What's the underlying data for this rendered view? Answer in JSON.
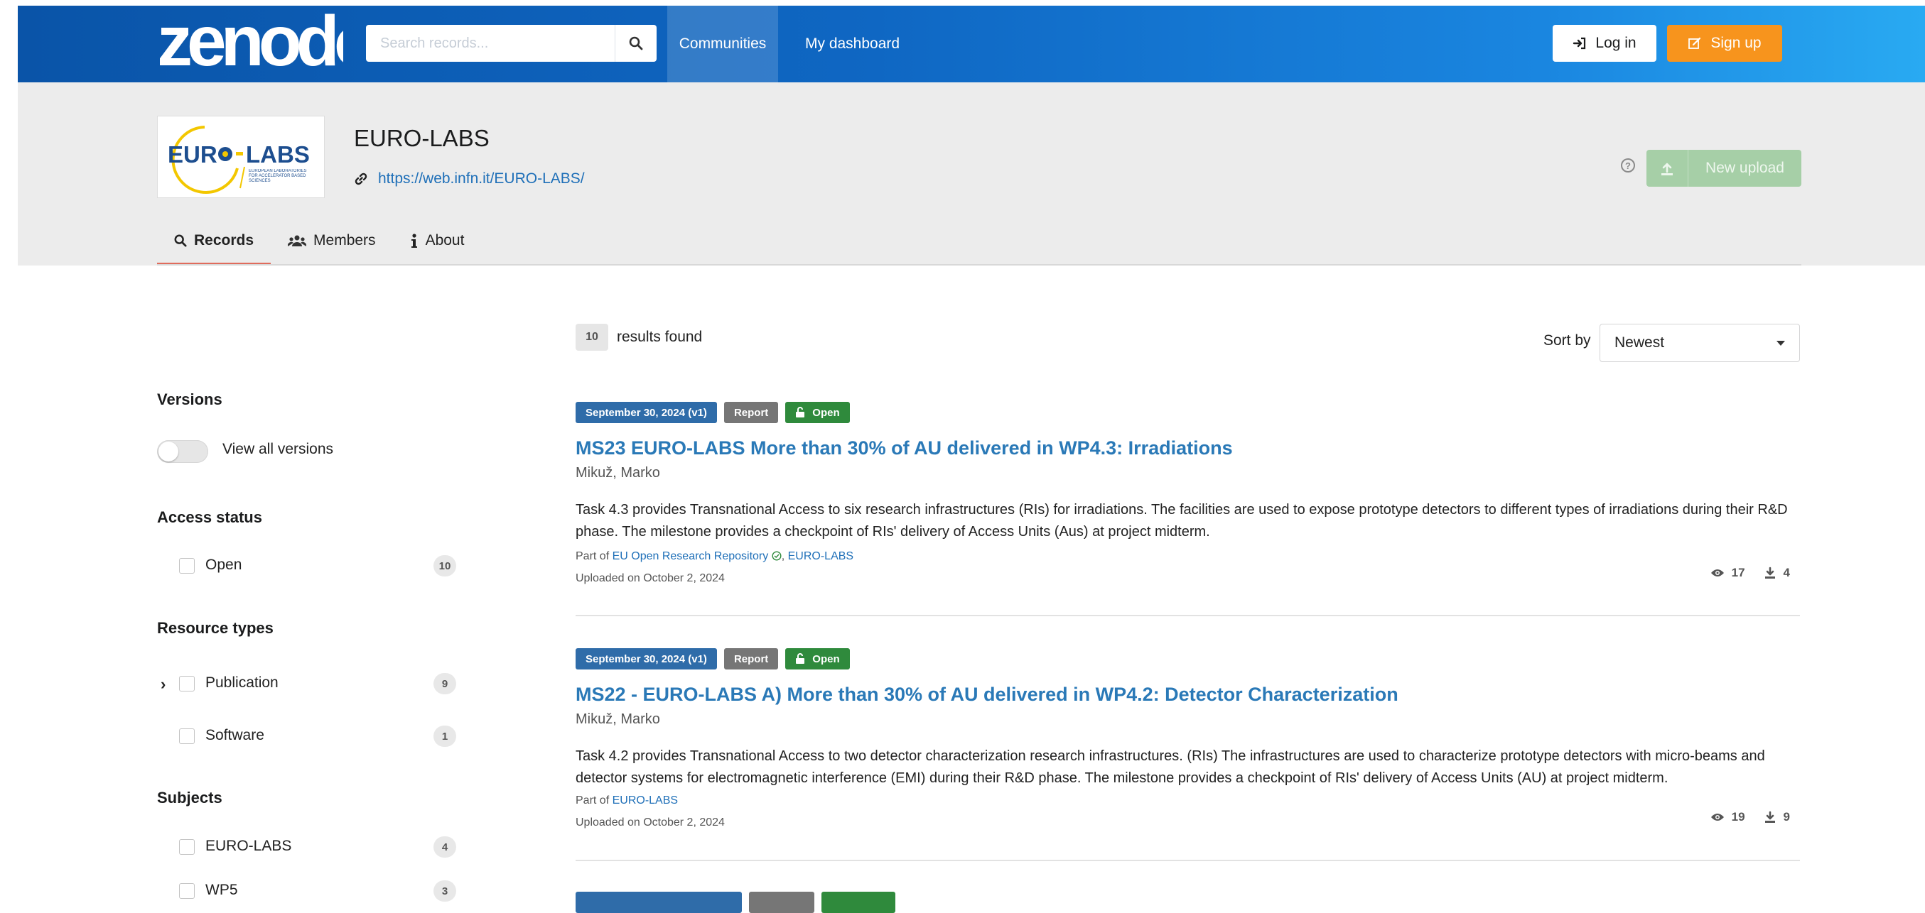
{
  "header": {
    "logo_text": "zenodo",
    "search_placeholder": "Search records...",
    "nav_communities": "Communities",
    "nav_dashboard": "My dashboard",
    "login_label": "Log in",
    "signup_label": "Sign up",
    "colors": {
      "gradient_start": "#0a54a8",
      "gradient_end": "#29aaf2",
      "signup": "#f7941d"
    }
  },
  "community": {
    "title": "EURO-LABS",
    "link": "https://web.infn.it/EURO-LABS/",
    "logo_text_1": "EUR",
    "logo_text_2": "LABS",
    "logo_tagline": "EUROPEAN LABORATORIES FOR ACCELERATOR BASED SCIENCES",
    "new_upload_label": "New upload",
    "tabs": [
      {
        "label": "Records",
        "icon": "search-icon",
        "active": true
      },
      {
        "label": "Members",
        "icon": "users-icon",
        "active": false
      },
      {
        "label": "About",
        "icon": "info-icon",
        "active": false
      }
    ]
  },
  "sidebar": {
    "versions_heading": "Versions",
    "view_all_versions": "View all versions",
    "access_heading": "Access status",
    "access_items": [
      {
        "label": "Open",
        "count": "10"
      }
    ],
    "resource_heading": "Resource types",
    "resource_items": [
      {
        "label": "Publication",
        "count": "9"
      },
      {
        "label": "Software",
        "count": "1"
      }
    ],
    "subjects_heading": "Subjects",
    "subject_items": [
      {
        "label": "EURO-LABS",
        "count": "4"
      },
      {
        "label": "WP5",
        "count": "3"
      }
    ]
  },
  "results": {
    "count": "10",
    "label": "results found",
    "sort_label": "Sort by",
    "sort_value": "Newest"
  },
  "records": [
    {
      "date": "September 30, 2024 (v1)",
      "type": "Report",
      "access": "Open",
      "title": "MS23 EURO-LABS More than 30% of AU delivered in WP4.3: Irradiations",
      "author": "Mikuž, Marko",
      "description": "Task 4.3 provides Transnational Access to six research infrastructures (RIs) for irradiations. The facilities are used to expose prototype detectors to different types of irradiations during their R&D phase. The milestone provides a checkpoint of RIs' delivery of Access Units (Aus) at project midterm.",
      "part_of_prefix": "Part of",
      "part_of_1": "EU Open Research Repository",
      "part_of_sep": ",",
      "part_of_2": "EURO-LABS",
      "uploaded": "Uploaded on October 2, 2024",
      "views": "17",
      "downloads": "4"
    },
    {
      "date": "September 30, 2024 (v1)",
      "type": "Report",
      "access": "Open",
      "title": "MS22 - EURO-LABS A) More than 30% of AU delivered in WP4.2: Detector Characterization",
      "author": "Mikuž, Marko",
      "description": "Task 4.2 provides Transnational Access to two detector characterization research infrastructures. (RIs) The infrastructures are used to characterize prototype detectors with micro-beams and detector systems for electromagnetic interference (EMI) during their R&D phase. The milestone provides a checkpoint of RIs' delivery of Access Units (AU) at project midterm.",
      "part_of_prefix": "Part of",
      "part_of_1": "EURO-LABS",
      "uploaded": "Uploaded on October 2, 2024",
      "views": "19",
      "downloads": "9"
    }
  ]
}
